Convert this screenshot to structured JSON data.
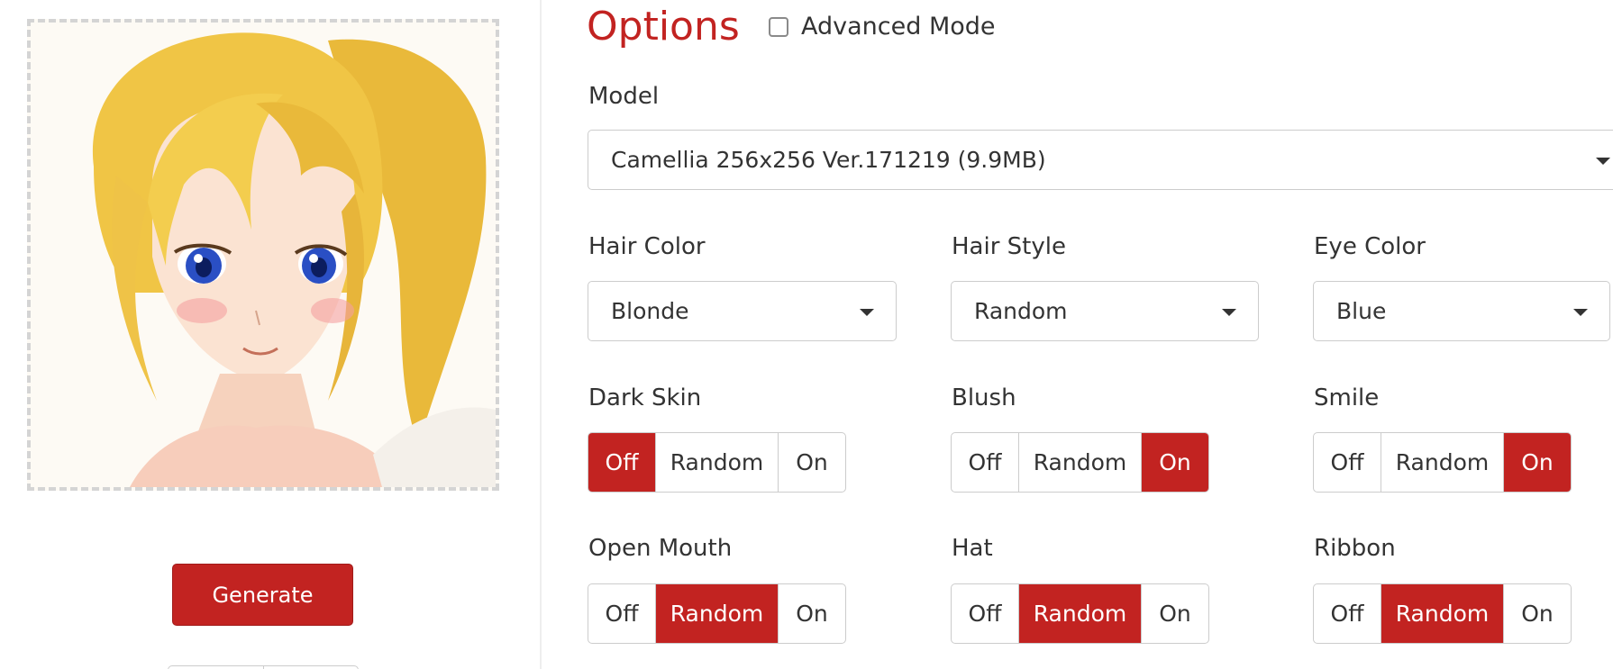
{
  "options": {
    "title": "Options",
    "advanced_mode_label": "Advanced Mode"
  },
  "model": {
    "label": "Model",
    "value": "Camellia 256x256 Ver.171219 (9.9MB)"
  },
  "selects": {
    "hair_color": {
      "label": "Hair Color",
      "value": "Blonde"
    },
    "hair_style": {
      "label": "Hair Style",
      "value": "Random"
    },
    "eye_color": {
      "label": "Eye Color",
      "value": "Blue"
    }
  },
  "toggle_options": {
    "off": "Off",
    "random": "Random",
    "on": "On"
  },
  "toggles": {
    "dark_skin": {
      "label": "Dark Skin",
      "selected": "Off"
    },
    "blush": {
      "label": "Blush",
      "selected": "On"
    },
    "smile": {
      "label": "Smile",
      "selected": "On"
    },
    "open_mouth": {
      "label": "Open Mouth",
      "selected": "Random"
    },
    "hat": {
      "label": "Hat",
      "selected": "Random"
    },
    "ribbon": {
      "label": "Ribbon",
      "selected": "Random"
    }
  },
  "actions": {
    "generate_label": "Generate"
  },
  "colors": {
    "accent": "#c22321",
    "border": "#cccccc",
    "text": "#333333"
  }
}
